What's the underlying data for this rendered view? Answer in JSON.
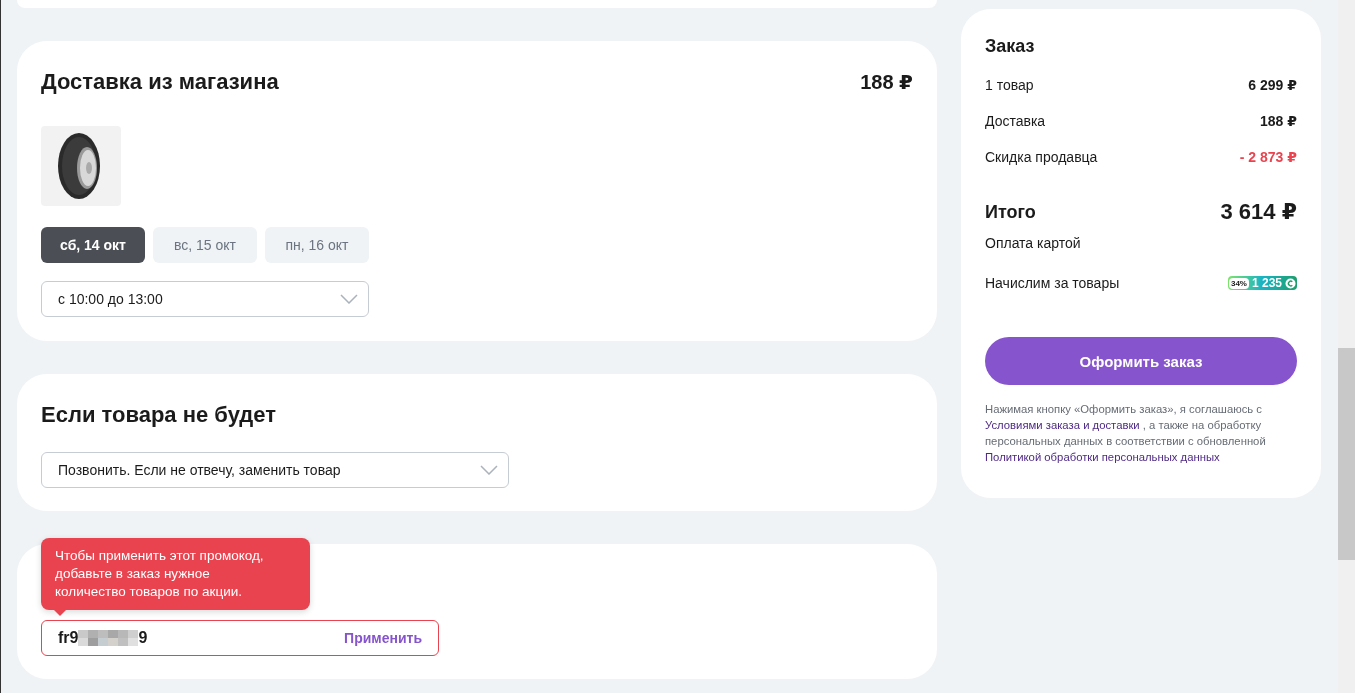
{
  "delivery": {
    "title": "Доставка из магазина",
    "price": "188 ₽",
    "dates": [
      {
        "label": "сб, 14 окт",
        "selected": true
      },
      {
        "label": "вс, 15 окт",
        "selected": false
      },
      {
        "label": "пн, 16 окт",
        "selected": false
      }
    ],
    "time_slot": "с 10:00 до 13:00"
  },
  "missing_item": {
    "title": "Если товара не будет",
    "option": "Позвонить. Если не отвечу, заменить товар"
  },
  "promo": {
    "error_tooltip": "Чтобы применить этот промокод, добавьте в заказ нужное количество товаров по акции.",
    "value_start": "fr9",
    "value_end": "9",
    "redacted": true,
    "apply_button": "Применить"
  },
  "order": {
    "title": "Заказ",
    "lines": [
      {
        "label": "1 товар",
        "value": "6 299 ₽",
        "kind": "normal"
      },
      {
        "label": "Доставка",
        "value": "188 ₽",
        "kind": "normal"
      },
      {
        "label": "Скидка продавца",
        "value": "- 2 873 ₽",
        "kind": "discount"
      }
    ],
    "total_label": "Итого",
    "total_value": "3 614 ₽",
    "payment": "Оплата картой",
    "bonus_label": "Начислим за товары",
    "bonus_percent": "34%",
    "bonus_amount": "1 235",
    "checkout_button": "Оформить заказ",
    "legal": {
      "before": "Нажимая кнопку «Оформить заказ», я соглашаюсь с",
      "link1": "Условиями заказа и доставки",
      "middle": ", а также на обработку персональных данных в соответствии с обновленной",
      "link2": "Политикой обработки персональных данных"
    }
  }
}
